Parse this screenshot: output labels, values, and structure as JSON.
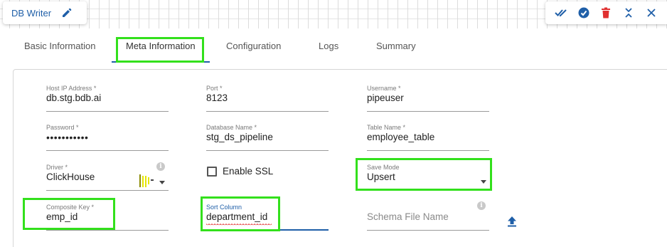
{
  "window": {
    "title": "DB Writer"
  },
  "tabs": [
    {
      "label": "Basic Information",
      "active": false
    },
    {
      "label": "Meta Information",
      "active": true
    },
    {
      "label": "Configuration",
      "active": false
    },
    {
      "label": "Logs",
      "active": false
    },
    {
      "label": "Summary",
      "active": false
    }
  ],
  "form": {
    "host": {
      "label": "Host IP Address *",
      "value": "db.stg.bdb.ai"
    },
    "port": {
      "label": "Port *",
      "value": "8123"
    },
    "username": {
      "label": "Username *",
      "value": "pipeuser"
    },
    "password": {
      "label": "Password *",
      "value": "•••••••••••"
    },
    "database": {
      "label": "Database Name *",
      "value": "stg_ds_pipeline"
    },
    "table": {
      "label": "Table Name *",
      "value": "employee_table"
    },
    "driver": {
      "label": "Driver *",
      "value": "ClickHouse"
    },
    "enable_ssl": {
      "label": "Enable SSL",
      "checked": false
    },
    "save_mode": {
      "label": "Save Mode",
      "value": "Upsert"
    },
    "composite_key": {
      "label": "Composite Key *",
      "value": "emp_id"
    },
    "sort_column": {
      "label": "Sort Column",
      "value": "department_id"
    },
    "schema_file": {
      "placeholder": "Schema File Name"
    }
  },
  "colors": {
    "accent": "#1f5fa8",
    "highlight": "#33e01c",
    "delete": "#e03030"
  },
  "icons": [
    "pencil-icon",
    "validate-icon",
    "run-icon",
    "delete-icon",
    "collapse-icon",
    "close-icon",
    "info-icon",
    "caret-down-icon",
    "upload-icon",
    "loading-icon"
  ]
}
